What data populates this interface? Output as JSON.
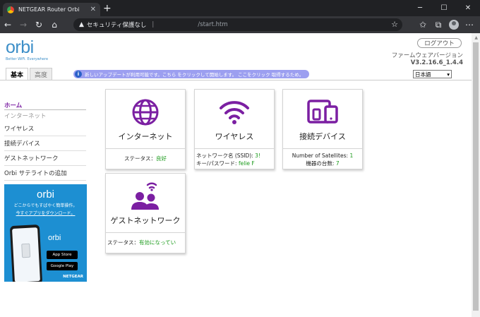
{
  "browser": {
    "tab_title": "NETGEAR Router Orbi",
    "new_tab": "+",
    "address": {
      "warning": "セキュリティ保護なし",
      "separator": "|",
      "url": "/start.htm"
    }
  },
  "header": {
    "logo": "orbi",
    "logo_tagline": "Better WiFi. Everywhere",
    "logout_label": "ログアウト",
    "firmware_label": "ファームウェアバージョン",
    "firmware_version": "V3.2.16.6_1.4.4"
  },
  "tabs": [
    {
      "label": "基本",
      "active": true
    },
    {
      "label": "高度",
      "active": false
    }
  ],
  "notice": {
    "icon": "i",
    "text": "新しいアップデートが利用可能です。こちら をクリックして開始します。 ここをクリック 取得するため。"
  },
  "language": {
    "selected": "日本語"
  },
  "sidebar": {
    "items": [
      {
        "label": "ホーム",
        "state": "active"
      },
      {
        "label": "インターネット",
        "state": "sub"
      },
      {
        "label": "ワイヤレス",
        "state": "normal"
      },
      {
        "label": "接続デバイス",
        "state": "normal"
      },
      {
        "label": "ゲストネットワーク",
        "state": "normal"
      },
      {
        "label": "Orbi サテライトの追加",
        "state": "normal"
      }
    ]
  },
  "promo": {
    "logo": "orbi",
    "text": "どこからでもすばやく簡単操作。",
    "link": "今すぐアプリをダウンロード。",
    "app_logo": "orbi",
    "app_store": "App Store",
    "google_play": "Google Play",
    "brand": "NETGEAR"
  },
  "cards": {
    "internet": {
      "title": "インターネット",
      "status_label": "ステータス：",
      "status_value": "良好"
    },
    "wireless": {
      "title": "ワイヤレス",
      "ssid_label": "ネットワーク名 (SSID):",
      "ssid_value": "3!",
      "key_label": "キー/パスワード:",
      "key_value": "felie F"
    },
    "devices": {
      "title": "接続デバイス",
      "satellites_label": "Number of Satellites:",
      "satellites_value": "1",
      "devices_label": "機器の台数:",
      "devices_value": "7"
    },
    "guest": {
      "title": "ゲストネットワーク",
      "status_label": "ステータス：",
      "status_value": "有効になってい"
    }
  },
  "colors": {
    "accent": "#7b1fa2",
    "orbi_blue": "#3d8fc8",
    "status_green": "#1a9a1a",
    "notice_bg": "#9c9ff0"
  }
}
